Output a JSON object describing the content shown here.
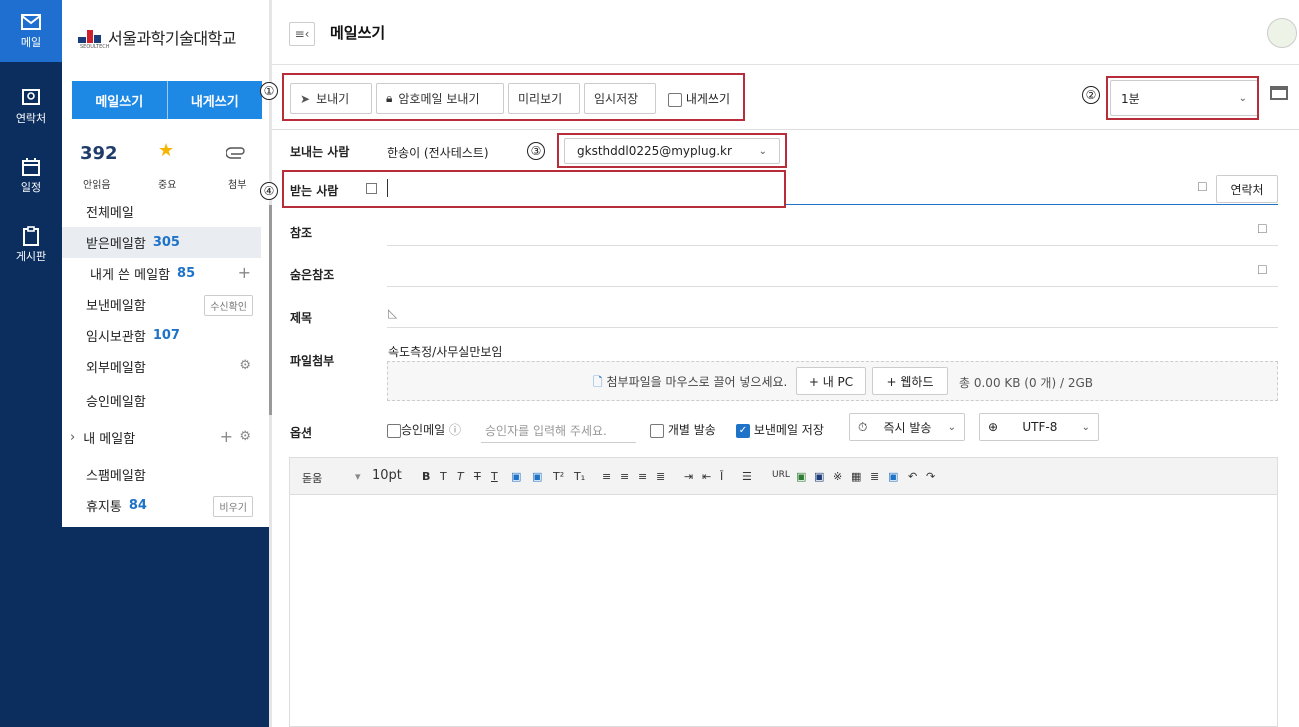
{
  "rail": {
    "items": [
      {
        "label": "메일",
        "icon": "mail-icon"
      },
      {
        "label": "연락처",
        "icon": "contact-icon"
      },
      {
        "label": "일정",
        "icon": "calendar-icon"
      },
      {
        "label": "게시판",
        "icon": "board-icon"
      }
    ]
  },
  "sidebar": {
    "logo_text": "서울과학기술대학교",
    "logo_sub": "SEOULTECH",
    "compose_label": "메일쓰기",
    "self_label": "내게쓰기",
    "stats": {
      "unread_count": "392",
      "unread_label": "안읽음",
      "important_label": "중요",
      "attach_label": "첨부"
    },
    "folders": [
      {
        "label": "전체메일",
        "count": ""
      },
      {
        "label": "받은메일함",
        "count": "305"
      },
      {
        "label": "내게 쓴 메일함",
        "count": "85"
      },
      {
        "label": "보낸메일함",
        "count": "",
        "btn": "수신확인"
      },
      {
        "label": "임시보관함",
        "count": "107"
      },
      {
        "label": "외부메일함",
        "count": ""
      },
      {
        "label": "승인메일함",
        "count": ""
      },
      {
        "label": "내 메일함",
        "count": ""
      },
      {
        "label": "스팸메일함",
        "count": ""
      },
      {
        "label": "휴지통",
        "count": "84",
        "btn": "비우기"
      }
    ]
  },
  "header": {
    "title": "메일쓰기"
  },
  "toolbar": {
    "send": "보내기",
    "encrypted_send": "암호메일 보내기",
    "preview": "미리보기",
    "draft": "임시저장",
    "to_self": "내게쓰기",
    "interval": "1분"
  },
  "markers": [
    "①",
    "②",
    "③",
    "④"
  ],
  "form": {
    "sender_label": "보내는 사람",
    "sender_name": "한송이 (전사테스트)",
    "sender_email": "gksthddl0225@myplug.kr",
    "to_label": "받는 사람",
    "to_value": "",
    "contacts_btn": "연락처",
    "cc_label": "참조",
    "bcc_label": "숨은참조",
    "subject_label": "제목",
    "attach_label": "파일첨부",
    "attach_file": "속도측정/사무실만보임",
    "attach_hint": "첨부파일을 마우스로 끌어 넣으세요.",
    "attach_pc": "+ 내 PC",
    "attach_webhard": "+ 웹하드",
    "attach_total": "총 0.00 KB (0 개) / 2GB",
    "options_label": "옵션",
    "approval": "승인메일",
    "approver_placeholder": "승인자를 입력해 주세요.",
    "individual": "개별 발송",
    "save_sent": "보낸메일 저장",
    "send_timing": "즉시 발송",
    "encoding": "UTF-8"
  },
  "editor": {
    "font": "돋움",
    "size": "10pt",
    "url_label": "URL"
  },
  "colors": {
    "rail": "#0b2e5e",
    "accent": "#1e88e5",
    "marker": "#b72e3a"
  }
}
